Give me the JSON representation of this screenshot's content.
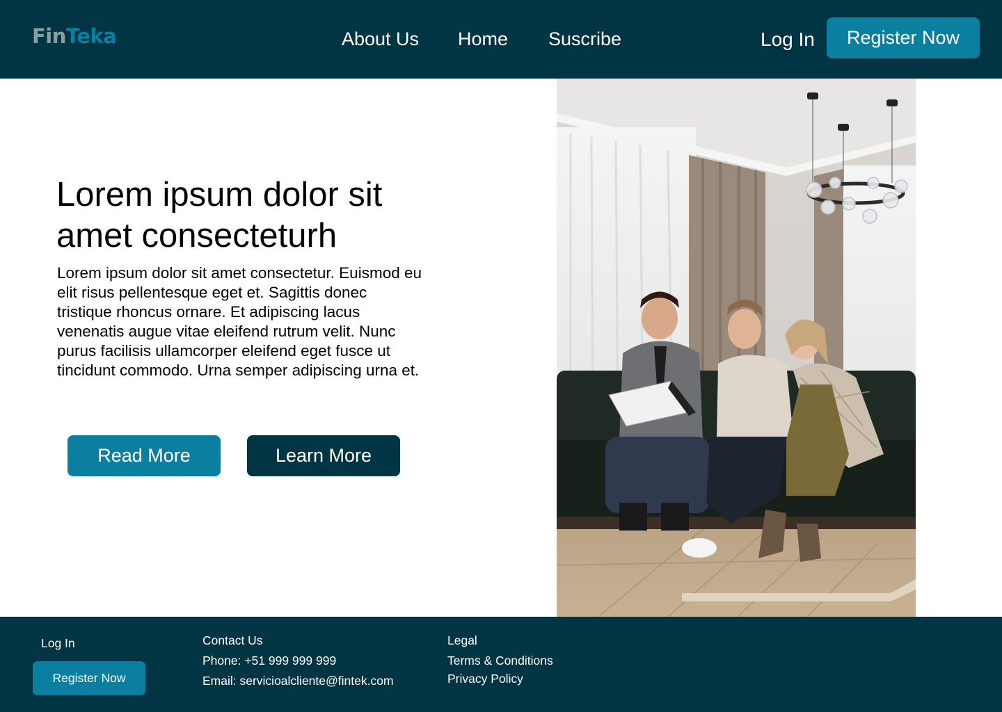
{
  "header": {
    "logo": {
      "part1": "Fin",
      "part2": "Teka"
    },
    "nav": [
      {
        "label": "About Us"
      },
      {
        "label": "Home"
      },
      {
        "label": "Suscribe"
      }
    ],
    "login_label": "Log In",
    "register_label": "Register Now"
  },
  "hero": {
    "title": "Lorem ipsum dolor sit amet consecteturh",
    "body": "Lorem ipsum dolor sit amet consectetur. Euismod eu elit risus pellentesque eget et. Sagittis donec tristique rhoncus ornare. Et adipiscing lacus venenatis augue vitae eleifend rutrum velit. Nunc purus facilisis ullamcorper eleifend eget fusce ut tincidunt commodo. Urna semper adipiscing urna et.",
    "read_more_label": "Read More",
    "learn_more_label": "Learn More"
  },
  "footer": {
    "login_label": "Log In",
    "register_label": "Register Now",
    "contact_heading": "Contact Us",
    "phone": "Phone: +51 999 999 999",
    "email": "Email: servicioalcliente@fintek.com",
    "legal_heading": "Legal",
    "terms_label": "Terms & Conditions",
    "privacy_label": "Privacy Policy"
  },
  "colors": {
    "navy": "#023543",
    "teal": "#0a7fa0",
    "logo_gray": "#8a9da3",
    "white": "#ffffff"
  }
}
